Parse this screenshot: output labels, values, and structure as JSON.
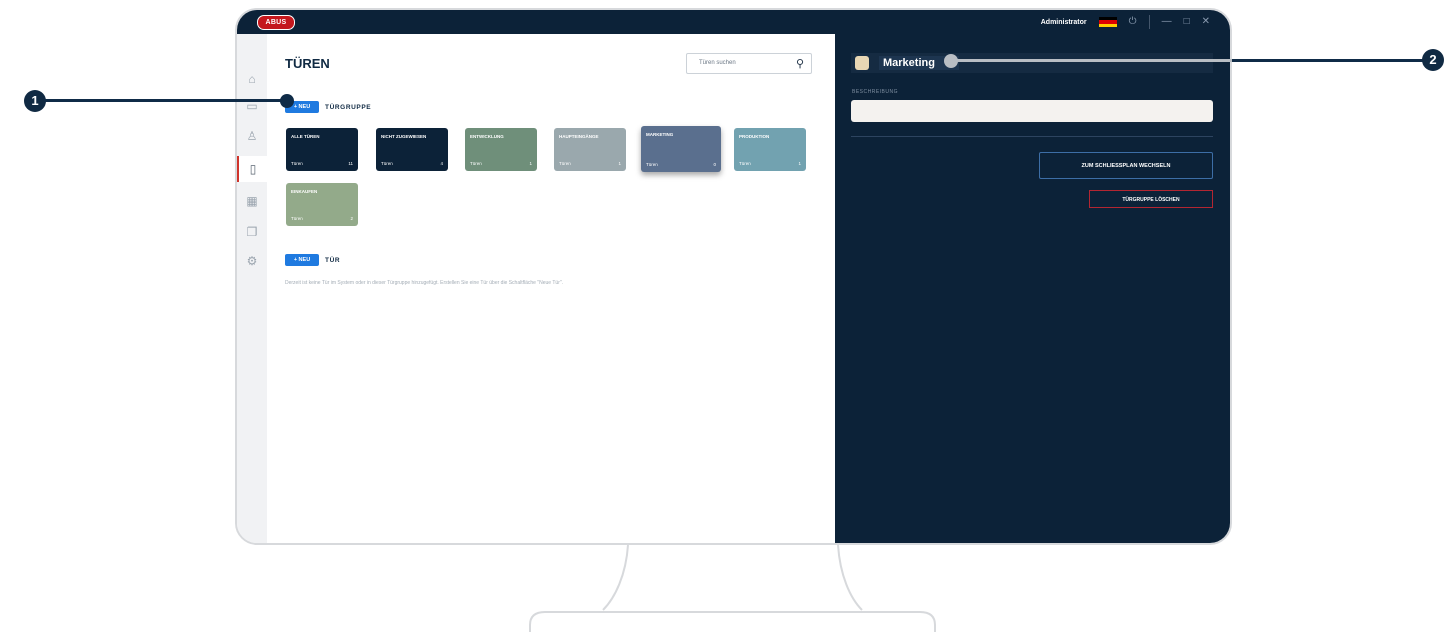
{
  "titlebar": {
    "logo": "ABUS",
    "user": "Administrator",
    "icons": [
      "german-flag",
      "power-icon",
      "minimize-icon",
      "maximize-icon",
      "close-icon"
    ]
  },
  "sidebar": {
    "items": [
      "home-icon",
      "calendar-icon",
      "user-icon",
      "door-icon",
      "schedule-icon",
      "devices-icon",
      "settings-icon"
    ],
    "active": "door-icon"
  },
  "main": {
    "title": "TÜREN",
    "search_placeholder": "Türen suchen",
    "new_label": "+ NEU",
    "groups_label": "TÜRGRUPPE",
    "door_label": "TÜR",
    "hint": "Derzeit ist keine Tür im System oder in dieser Türgruppe hinzugefügt. Erstellen Sie eine Tür über die Schaltfläche \"Neue Tür\".",
    "groups": [
      {
        "name": "ALLE TÜREN",
        "sub": "Türen",
        "count": "11",
        "color": "#0c2238"
      },
      {
        "name": "NICHT ZUGEWIESEN",
        "sub": "Türen",
        "count": "4",
        "color": "#0c2238"
      },
      {
        "name": "ENTWICKLUNG",
        "sub": "Türen",
        "count": "1",
        "color": "#6f8f7a"
      },
      {
        "name": "HAUPTEINGÄNGE",
        "sub": "Türen",
        "count": "1",
        "color": "#9aa8ad"
      },
      {
        "name": "MARKETING",
        "sub": "Türen",
        "count": "0",
        "color": "#5a6f8e",
        "selected": true
      },
      {
        "name": "PRODUKTION",
        "sub": "Türen",
        "count": "1",
        "color": "#72a2b0"
      },
      {
        "name": "EINKAUFEN",
        "sub": "Türen",
        "count": "2",
        "color": "#93aa8a"
      }
    ]
  },
  "panel": {
    "title": "Marketing",
    "swatch_color": "#e8d7b4",
    "desc_label": "BESCHREIBUNG",
    "desc_value": "",
    "switch_button": "ZUM SCHLIESSPLAN WECHSELN",
    "delete_button": "TÜRGRUPPE LÖSCHEN"
  },
  "callouts": [
    "1",
    "2"
  ]
}
